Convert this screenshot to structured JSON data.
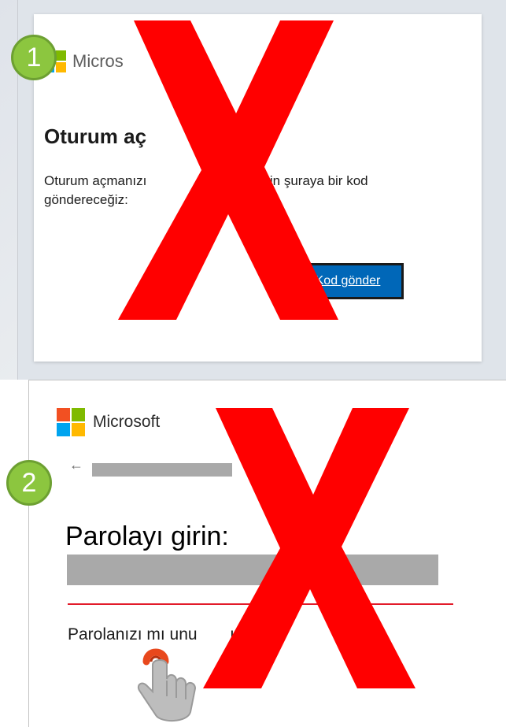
{
  "panel1": {
    "brand": "Micros",
    "title": "Oturum aç",
    "description_part1": "Oturum açmanızı",
    "description_part2": "çin şuraya bir kod",
    "description_line2": "göndereceğiz:",
    "send_button_label": "Kod gönder",
    "badge": "1"
  },
  "panel2": {
    "brand": "Microsoft",
    "back_arrow": "←",
    "title": "Parolayı girin:",
    "forgot_part1": "Parolanızı mı unu",
    "forgot_part2": "uz?",
    "badge": "2"
  },
  "colors": {
    "overlay_x": "#ff0000",
    "badge_fill": "#8cc63f",
    "button_blue": "#0067b8",
    "error_line": "#e21b2a",
    "redaction_gray": "#a9a9a9"
  },
  "icons": {
    "logo": "microsoft-logo-icon",
    "back": "back-arrow-icon",
    "cursor": "hand-pointer-icon",
    "overlay": "cross-x-icon"
  }
}
